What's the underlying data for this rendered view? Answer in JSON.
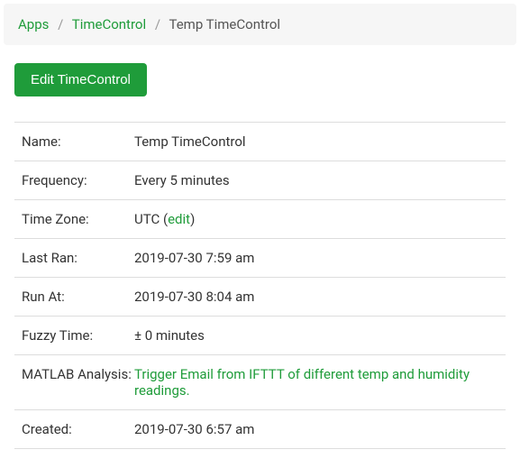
{
  "breadcrumb": {
    "apps": "Apps",
    "timecontrol": "TimeControl",
    "current": "Temp TimeControl"
  },
  "edit_button_label": "Edit TimeControl",
  "rows": {
    "name": {
      "label": "Name:",
      "value": "Temp TimeControl"
    },
    "frequency": {
      "label": "Frequency:",
      "value": "Every 5 minutes"
    },
    "timezone": {
      "label": "Time Zone:",
      "value_prefix": "UTC (",
      "edit_link": "edit",
      "value_suffix": ")"
    },
    "last_ran": {
      "label": "Last Ran:",
      "value": "2019-07-30 7:59 am"
    },
    "run_at": {
      "label": "Run At:",
      "value": "2019-07-30 8:04 am"
    },
    "fuzzy_time": {
      "label": "Fuzzy Time:",
      "value": "± 0 minutes"
    },
    "matlab_analysis": {
      "label": "MATLAB Analysis:",
      "link": "Trigger Email from IFTTT of different temp and humidity readings."
    },
    "created": {
      "label": "Created:",
      "value": "2019-07-30 6:57 am"
    }
  }
}
